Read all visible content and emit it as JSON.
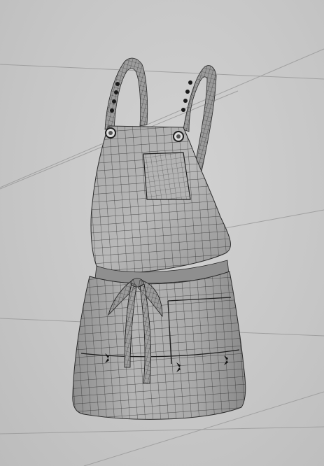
{
  "viewport": {
    "background_color": "#c9c9c9",
    "grid_color": "#9c9c9c",
    "mesh_fill": "#a9a9a9",
    "mesh_wire": "#2a2a2a"
  },
  "model": {
    "object": "apron-icon",
    "display_mode": "wireframe-on-shaded"
  }
}
